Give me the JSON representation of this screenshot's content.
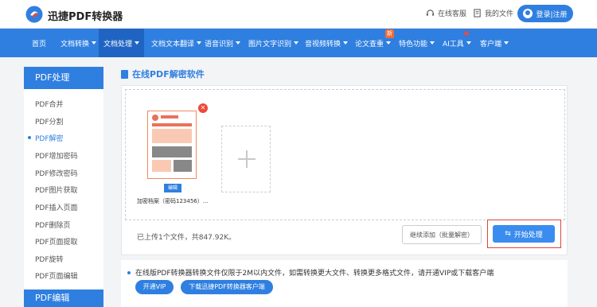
{
  "header": {
    "app_title": "迅捷PDF转换器",
    "service_label": "在线客服",
    "files_label": "我的文件",
    "login_label": "登录|注册"
  },
  "nav": {
    "items": [
      {
        "label": "首页"
      },
      {
        "label": "文档转换"
      },
      {
        "label": "文档处理"
      },
      {
        "label": "文档文本翻译"
      },
      {
        "label": "语音识别"
      },
      {
        "label": "图片文字识别"
      },
      {
        "label": "音视频转换"
      },
      {
        "label": "论文查重"
      },
      {
        "label": "特色功能"
      },
      {
        "label": "AI工具"
      },
      {
        "label": "客户端"
      }
    ],
    "new_badge": "新"
  },
  "sidebar": {
    "heading": "PDF处理",
    "items": [
      {
        "label": "PDF合并"
      },
      {
        "label": "PDF分割"
      },
      {
        "label": "PDF解密"
      },
      {
        "label": "PDF增加密码"
      },
      {
        "label": "PDF修改密码"
      },
      {
        "label": "PDF图片获取"
      },
      {
        "label": "PDF插入页面"
      },
      {
        "label": "PDF删除页"
      },
      {
        "label": "PDF页面提取"
      },
      {
        "label": "PDF旋转"
      },
      {
        "label": "PDF页面编辑"
      }
    ],
    "heading2": "PDF编辑"
  },
  "main": {
    "title": "在线PDF解密软件",
    "file": {
      "edit_label": "编辑",
      "name": "加密档案（密码123456）..."
    },
    "upload_info": "已上传1个文件，共847.92K。",
    "continue_label": "继续添加（批量解密）",
    "start_label": "开始处理",
    "note": "在线版PDF转换器转换文件仅限于2M以内文件，如需转换更大文件、转换更多格式文件，请开通VIP或下载客户端",
    "vip_label": "开通VIP",
    "download_label": "下载迅捷PDF转换器客户端"
  },
  "colors": {
    "primary": "#2f7fe0",
    "nav_active": "#1f64c2",
    "highlight_red": "#e0433a"
  }
}
